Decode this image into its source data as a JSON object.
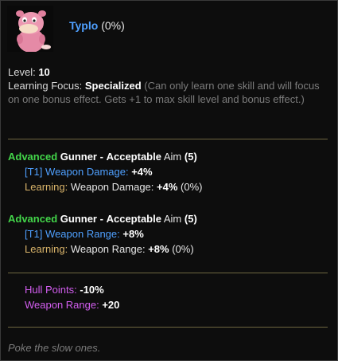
{
  "header": {
    "name": "Typlo",
    "percent": "(0%)"
  },
  "info": {
    "level_label": "Level:",
    "level_value": "10",
    "focus_label": "Learning Focus:",
    "focus_value": "Specialized",
    "focus_desc": "(Can only learn one skill and will focus on one bonus effect. Gets +1 to max skill level and bonus effect.)"
  },
  "skills": [
    {
      "tier_word": "Advanced",
      "class_word": "Gunner",
      "sep": "-",
      "quality_word": "Acceptable",
      "stat_word": "Aim",
      "stat_value": "(5)",
      "tier_tag": "[T1]",
      "bonus_label": "Weapon Damage:",
      "bonus_value": "+4%",
      "learning_label": "Learning:",
      "learning_stat": "Weapon Damage:",
      "learning_value": "+4%",
      "learning_pct": "(0%)"
    },
    {
      "tier_word": "Advanced",
      "class_word": "Gunner",
      "sep": "-",
      "quality_word": "Acceptable",
      "stat_word": "Aim",
      "stat_value": "(5)",
      "tier_tag": "[T1]",
      "bonus_label": "Weapon Range:",
      "bonus_value": "+8%",
      "learning_label": "Learning:",
      "learning_stat": "Weapon Range:",
      "learning_value": "+8%",
      "learning_pct": "(0%)"
    }
  ],
  "stats": [
    {
      "label": "Hull Points:",
      "value": "-10%"
    },
    {
      "label": "Weapon Range:",
      "value": "+20"
    }
  ],
  "flavor": "Poke the slow ones.",
  "colors": {
    "name": "#4fa0ff",
    "advanced": "#43d64a",
    "learning": "#d9b46a",
    "stat_label": "#d35ef0",
    "divider": "#6e6640"
  },
  "portrait_icon": "pink-creature-portrait"
}
